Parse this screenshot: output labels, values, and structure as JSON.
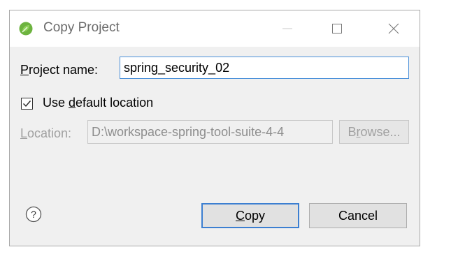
{
  "window": {
    "title": "Copy Project",
    "controls": [
      "minimize",
      "maximize",
      "close"
    ]
  },
  "project": {
    "label_underline": "P",
    "label_rest": "roject name:",
    "value": "spring_security_02"
  },
  "default_location": {
    "checked": true,
    "label_pre": "Use ",
    "label_underline": "d",
    "label_rest": "efault location"
  },
  "location": {
    "label_underline": "L",
    "label_rest": "ocation:",
    "value": "D:\\workspace-spring-tool-suite-4-4",
    "enabled": false
  },
  "buttons": {
    "browse_pre": "B",
    "browse_underline": "r",
    "browse_rest": "owse...",
    "copy_underline": "C",
    "copy_rest": "opy",
    "cancel": "Cancel"
  },
  "colors": {
    "accent": "#3c7fd1",
    "app_icon": "#6db33f"
  },
  "icons": {
    "app": "spring-leaf-icon",
    "help": "help-icon"
  }
}
